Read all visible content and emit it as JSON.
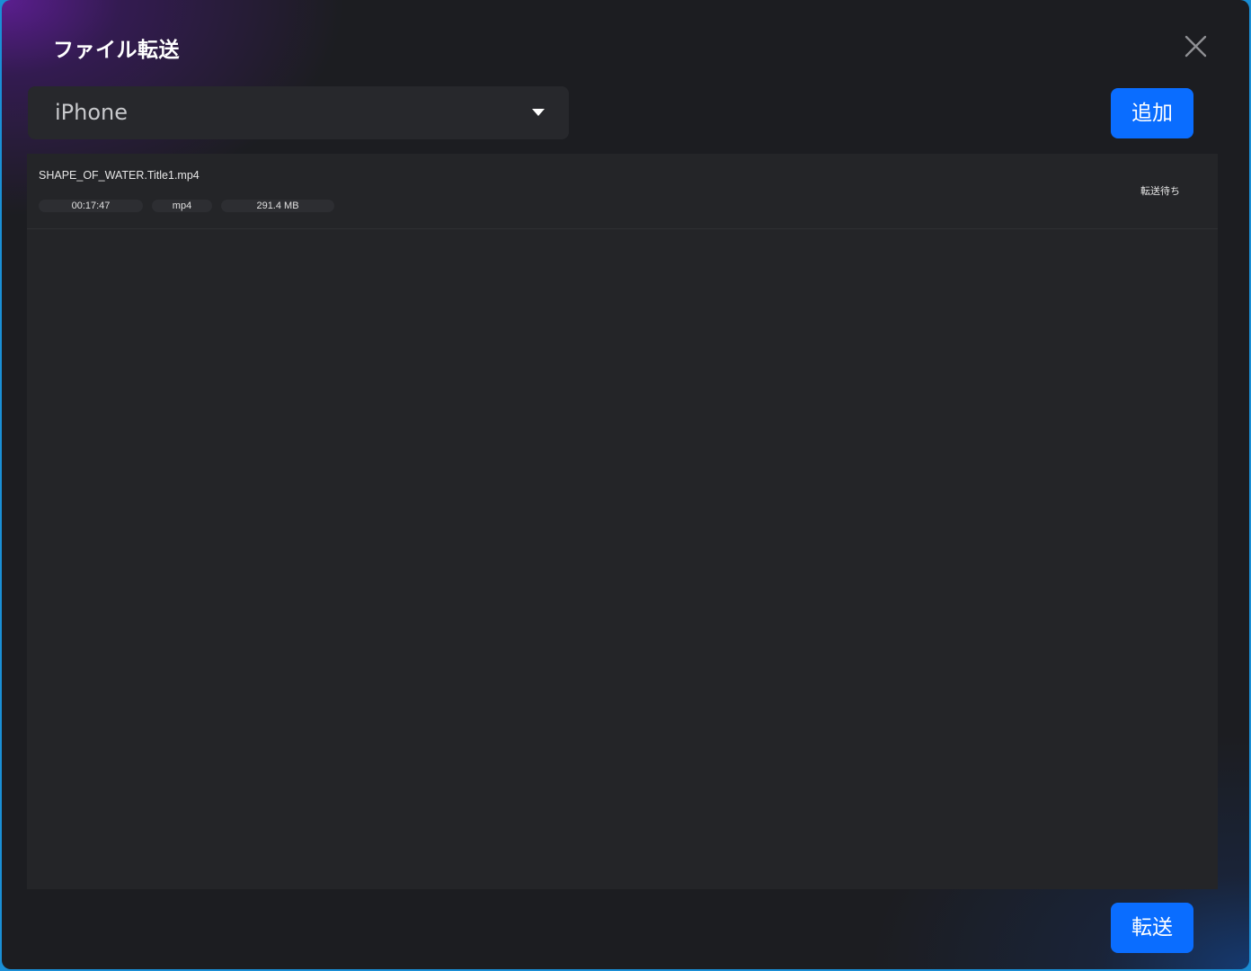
{
  "dialog": {
    "title": "ファイル転送",
    "close_icon": "close-icon"
  },
  "device_select": {
    "selected": "iPhone",
    "icon": "caret-down-icon"
  },
  "buttons": {
    "add_label": "追加",
    "transfer_label": "転送"
  },
  "files": [
    {
      "name": "SHAPE_OF_WATER.Title1.mp4",
      "duration": "00:17:47",
      "format": "mp4",
      "size": "291.4 MB",
      "status": "転送待ち"
    }
  ],
  "colors": {
    "accent": "#0a6dff",
    "background": "#1c1d21",
    "panel": "#242528"
  }
}
